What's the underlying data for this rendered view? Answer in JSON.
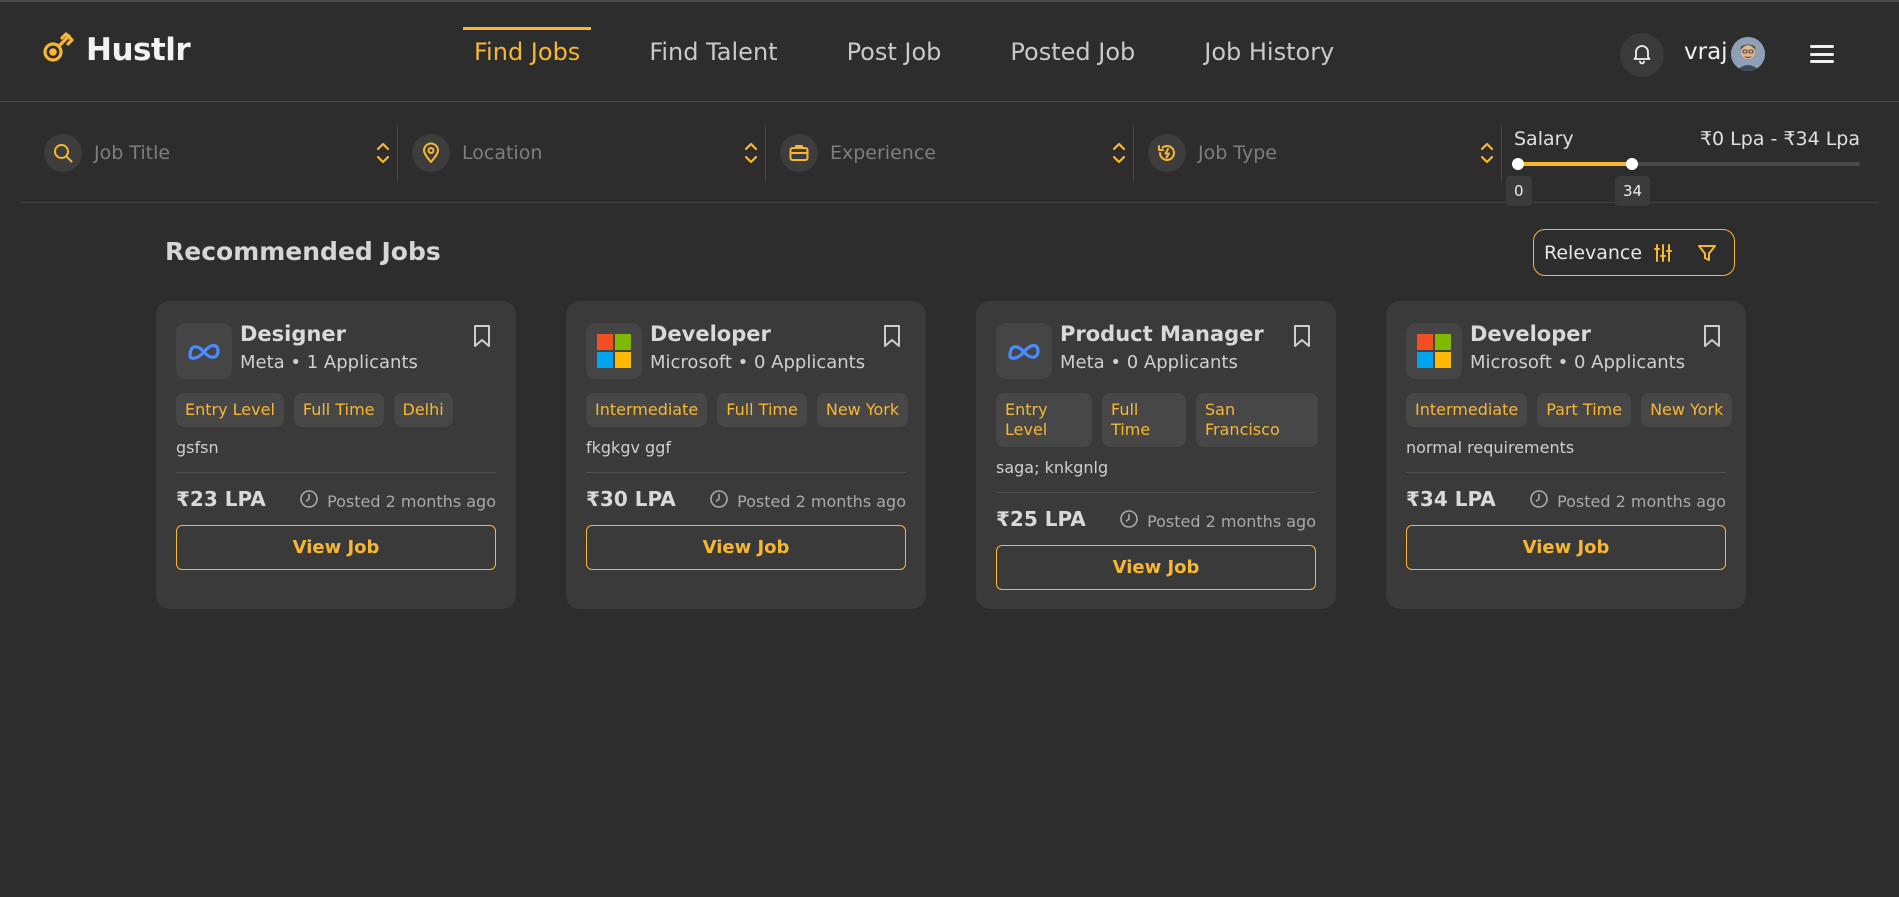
{
  "app": {
    "name": "Hustlr"
  },
  "nav": [
    {
      "label": "Find Jobs",
      "active": true
    },
    {
      "label": "Find Talent"
    },
    {
      "label": "Post Job"
    },
    {
      "label": "Posted Job"
    },
    {
      "label": "Job History"
    }
  ],
  "user": {
    "name": "vraj"
  },
  "filters": {
    "job_title": "Job Title",
    "location": "Location",
    "experience": "Experience",
    "job_type": "Job Type"
  },
  "salary": {
    "label": "Salary",
    "range_text": "₹0 Lpa - ₹34 Lpa",
    "min": "0",
    "max": "34",
    "fill_fraction": 0.34
  },
  "section": {
    "title": "Recommended Jobs",
    "sort_label": "Relevance"
  },
  "jobs": [
    {
      "title": "Designer",
      "company": "Meta • 1 Applicants",
      "logo": "meta-logo",
      "tags": [
        "Entry Level",
        "Full Time",
        "Delhi"
      ],
      "desc": "gsfsn",
      "price": "₹23 LPA",
      "posted": "Posted 2 months ago",
      "button": "View Job"
    },
    {
      "title": "Developer",
      "company": "Microsoft • 0 Applicants",
      "logo": "microsoft-logo",
      "tags": [
        "Intermediate",
        "Full Time",
        "New York"
      ],
      "desc": "fkgkgv ggf",
      "price": "₹30 LPA",
      "posted": "Posted 2 months ago",
      "button": "View Job"
    },
    {
      "title": "Product Manager",
      "company": "Meta • 0 Applicants",
      "logo": "meta-logo",
      "tags": [
        "Entry Level",
        "Full Time",
        "San Francisco"
      ],
      "desc": "saga; knkgnlg",
      "price": "₹25 LPA",
      "posted": "Posted 2 months ago",
      "button": "View Job"
    },
    {
      "title": "Developer",
      "company": "Microsoft • 0 Applicants",
      "logo": "microsoft-logo",
      "tags": [
        "Intermediate",
        "Part Time",
        "New York"
      ],
      "desc": "normal requirements",
      "price": "₹34 LPA",
      "posted": "Posted 2 months ago",
      "button": "View Job"
    }
  ],
  "colors": {
    "accent": "#f7b733",
    "background": "#2d2d2d",
    "card": "#3a3a3a"
  }
}
